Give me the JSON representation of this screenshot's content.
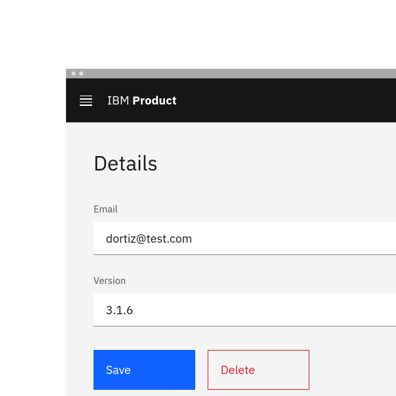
{
  "header": {
    "brand_light": "IBM ",
    "brand_bold": "Product"
  },
  "page": {
    "title": "Details"
  },
  "fields": {
    "email": {
      "label": "Email",
      "value": "dortiz@test.com"
    },
    "version": {
      "label": "Version",
      "value": "3.1.6"
    }
  },
  "buttons": {
    "save": "Save",
    "delete": "Delete"
  },
  "colors": {
    "primary": "#0f62fe",
    "danger": "#da1e28",
    "header_bg": "#161616",
    "page_bg": "#f4f4f4"
  }
}
